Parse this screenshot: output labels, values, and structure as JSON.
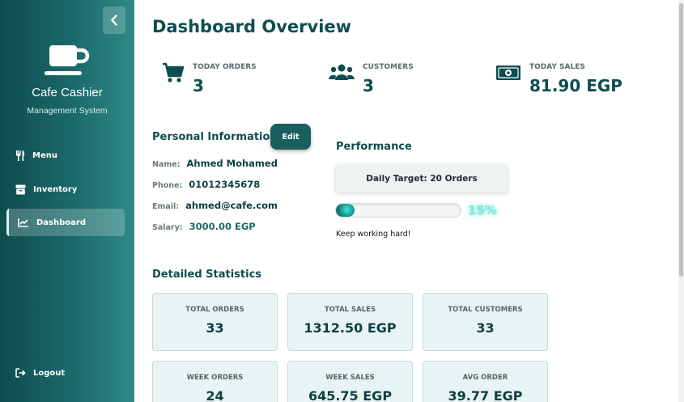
{
  "sidebar": {
    "brand_title": "Cafe Cashier",
    "brand_subtitle": "Management System",
    "items": [
      {
        "label": "Menu",
        "icon": "utensils-icon"
      },
      {
        "label": "Inventory",
        "icon": "box-icon"
      },
      {
        "label": "Dashboard",
        "icon": "chart-line-icon",
        "active": true
      }
    ],
    "logout_label": "Logout"
  },
  "main": {
    "title": "Dashboard Overview",
    "stats": [
      {
        "label": "TODAY ORDERS",
        "value": "3",
        "icon": "shopping-cart-icon"
      },
      {
        "label": "CUSTOMERS",
        "value": "3",
        "icon": "users-icon"
      },
      {
        "label": "TODAY SALES",
        "value": "81.90 EGP",
        "icon": "money-bill-icon"
      }
    ],
    "personal": {
      "title": "Personal Information",
      "edit_label": "Edit",
      "fields": [
        {
          "key": "Name:",
          "value": "Ahmed Mohamed"
        },
        {
          "key": "Phone:",
          "value": "01012345678"
        },
        {
          "key": "Email:",
          "value": "ahmed@cafe.com"
        },
        {
          "key": "Salary:",
          "value": "3000.00 EGP"
        }
      ]
    },
    "performance": {
      "title": "Performance",
      "target_label": "Daily Target: 20 Orders",
      "progress": 15,
      "progress_text": "15%",
      "message": "Keep working hard!"
    },
    "detailed": {
      "title": "Detailed Statistics",
      "cards": [
        {
          "label": "TOTAL ORDERS",
          "value": "33"
        },
        {
          "label": "TOTAL SALES",
          "value": "1312.50 EGP"
        },
        {
          "label": "TOTAL CUSTOMERS",
          "value": "33"
        },
        {
          "label": "WEEK ORDERS",
          "value": "24"
        },
        {
          "label": "WEEK SALES",
          "value": "645.75 EGP"
        },
        {
          "label": "AVG ORDER",
          "value": "39.77 EGP"
        }
      ]
    }
  },
  "colors": {
    "primary": "#0e4d50",
    "sidebar_dark": "#0f4c4f",
    "sidebar_light": "#2f8a87",
    "card_bg": "#e8f3f3",
    "accent_glow": "#7fe6dd"
  }
}
